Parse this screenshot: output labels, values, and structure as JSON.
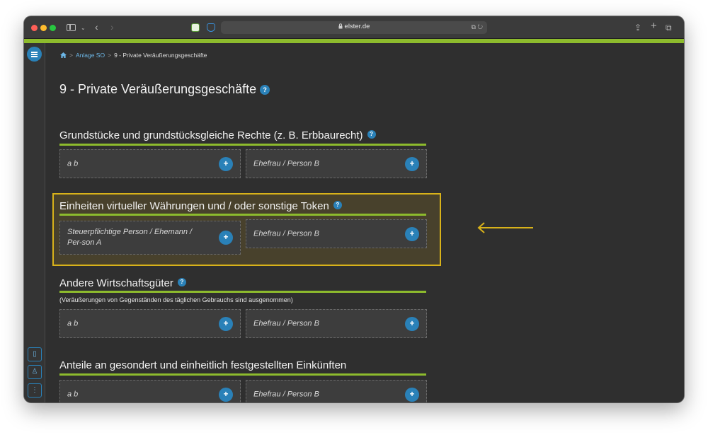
{
  "browser": {
    "url": "elster.de"
  },
  "breadcrumb": {
    "items": [
      "Anlage SO",
      "9 - Private Veräußerungsgeschäfte"
    ]
  },
  "page": {
    "title": "9 - Private Veräußerungsgeschäfte",
    "help": "?"
  },
  "sections": [
    {
      "title": "Grundstücke und grundstücksgleiche Rechte (z. B. Erbbaurecht)",
      "note": "",
      "cards": [
        "a b",
        "Ehefrau / Person B"
      ]
    },
    {
      "title": "Einheiten virtueller Währungen und / oder sonstige Token",
      "note": "",
      "cards": [
        "Steuerpflichtige Person / Ehemann / Per-son A",
        "Ehefrau / Person B"
      ]
    },
    {
      "title": "Andere Wirtschaftsgüter",
      "note": "(Veräußerungen von Gegenständen des täglichen Gebrauchs sind ausgenommen)",
      "cards": [
        "a b",
        "Ehefrau / Person B"
      ]
    },
    {
      "title": "Anteile an gesondert und einheitlich festgestellten Einkünften",
      "note": "",
      "cards": [
        "a b",
        "Ehefrau / Person B"
      ]
    }
  ],
  "colors": {
    "accent_green": "#8dbb2d",
    "accent_blue": "#2a81b8",
    "highlight": "#d8b21a"
  }
}
